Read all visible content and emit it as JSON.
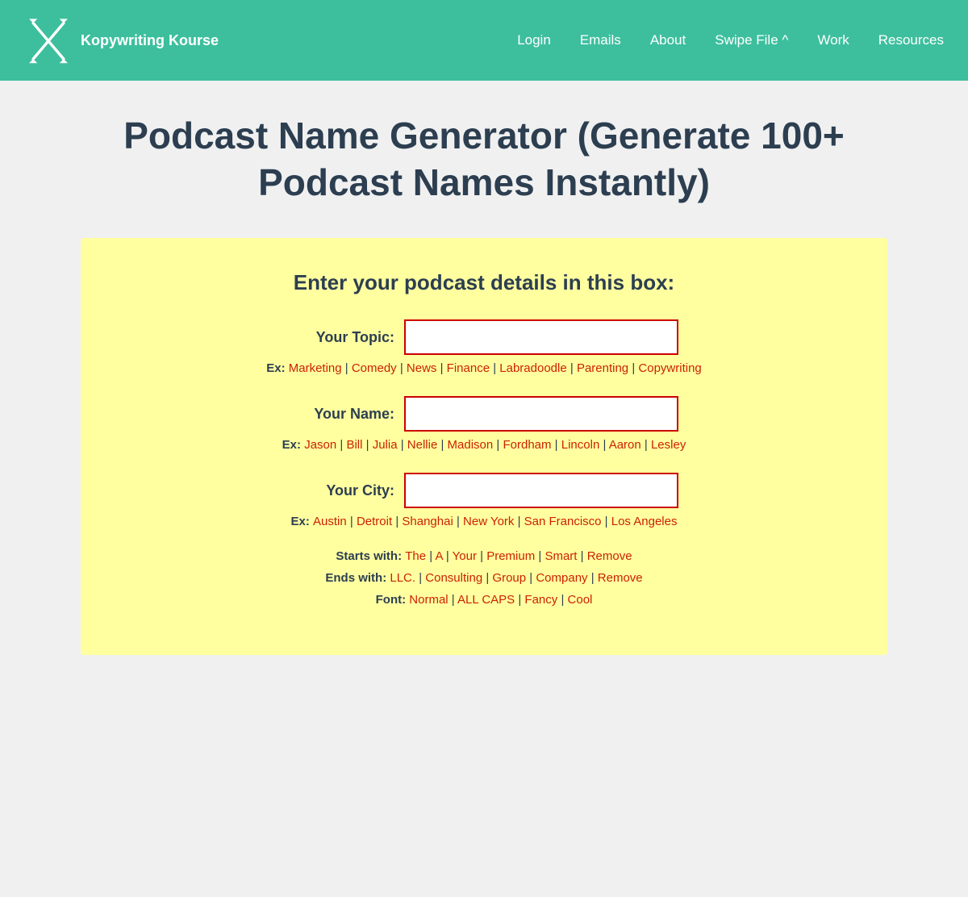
{
  "nav": {
    "brand": "Kopywriting Kourse",
    "links": [
      {
        "label": "Login",
        "name": "nav-login"
      },
      {
        "label": "Emails",
        "name": "nav-emails"
      },
      {
        "label": "About",
        "name": "nav-about"
      },
      {
        "label": "Swipe File ^",
        "name": "nav-swipefile"
      },
      {
        "label": "Work",
        "name": "nav-work"
      },
      {
        "label": "Resources",
        "name": "nav-resources"
      }
    ]
  },
  "page": {
    "title": "Podcast Name Generator (Generate 100+ Podcast Names Instantly)"
  },
  "generator": {
    "heading": "Enter your podcast details in this box:",
    "topic_label": "Your Topic:",
    "topic_placeholder": "",
    "topic_examples_label": "Ex:",
    "topic_examples": [
      "Marketing",
      "Comedy",
      "News",
      "Finance",
      "Labradoodle",
      "Parenting",
      "Copywriting"
    ],
    "name_label": "Your Name:",
    "name_placeholder": "",
    "name_examples_label": "Ex:",
    "name_examples": [
      "Jason",
      "Bill",
      "Julia",
      "Nellie",
      "Madison",
      "Fordham",
      "Lincoln",
      "Aaron",
      "Lesley"
    ],
    "city_label": "Your City:",
    "city_placeholder": "",
    "city_examples_label": "Ex:",
    "city_examples": [
      "Austin",
      "Detroit",
      "Shanghai",
      "New York",
      "San Francisco",
      "Los Angeles"
    ],
    "starts_with_label": "Starts with:",
    "starts_with_options": [
      "The",
      "A",
      "Your",
      "Premium",
      "Smart",
      "Remove"
    ],
    "ends_with_label": "Ends with:",
    "ends_with_options": [
      "LLC.",
      "Consulting",
      "Group",
      "Company",
      "Remove"
    ],
    "font_label": "Font:",
    "font_options": [
      "Normal",
      "ALL CAPS",
      "Fancy",
      "Cool"
    ]
  }
}
